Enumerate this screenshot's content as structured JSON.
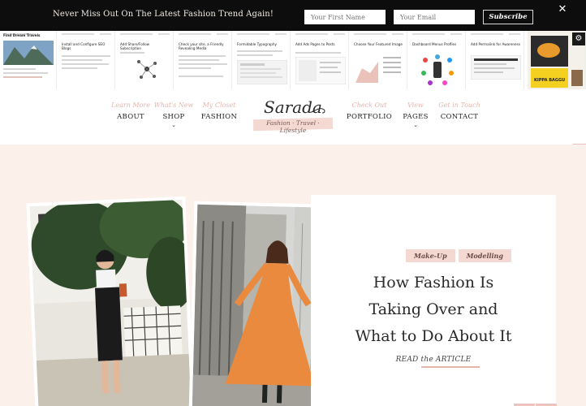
{
  "optin": {
    "message": "Never Miss Out On The Latest Fashion Trend Again!",
    "first_name_placeholder": "Your First Name",
    "email_placeholder": "Your Email",
    "subscribe_label": "Subscribe",
    "close_label": "✕"
  },
  "thumbnails": [
    {
      "title": "Find Dream Travels"
    },
    {
      "title": "Install and Configure SEO Blogs"
    },
    {
      "title": "Add Share/Follow Subscription"
    },
    {
      "title": "Check your site, a Friendly Revealing Media"
    },
    {
      "title": "Formidable Typography"
    },
    {
      "title": "Add Ads Pages to Posts"
    },
    {
      "title": "Choose Your Featured Image"
    },
    {
      "title": "Dashboard Menus Profiles"
    },
    {
      "title": "Add Permalink for Awareness"
    },
    {
      "title": "KIPPA BAGGU"
    }
  ],
  "settings_icon": "⚙",
  "nav": {
    "left": [
      {
        "sub": "Learn More",
        "label": "ABOUT",
        "has_dropdown": false
      },
      {
        "sub": "What's New",
        "label": "SHOP",
        "has_dropdown": true
      },
      {
        "sub": "My Closet",
        "label": "FASHION",
        "has_dropdown": false
      }
    ],
    "right": [
      {
        "sub": "Check Out",
        "label": "PORTFOLIO",
        "has_dropdown": false
      },
      {
        "sub": "View",
        "label": "PAGES",
        "has_dropdown": true
      },
      {
        "sub": "Get in Touch",
        "label": "CONTACT",
        "has_dropdown": false
      }
    ],
    "chevron": "⌄"
  },
  "logo": {
    "brand": "Sarada",
    "tagline": "Fashion · Travel · Lifestyle"
  },
  "feature": {
    "tags": [
      "Make-Up",
      "Modelling"
    ],
    "headline_lines": [
      "How Fashion Is",
      "Taking Over and",
      "What to Do About It"
    ],
    "read_label": "READ the ARTICLE"
  },
  "colors": {
    "accent_pink": "#f4d9d3",
    "nav_script": "#e6b6ad",
    "hero_bg": "#fbf0ea",
    "bar_bg": "#0d0d0d"
  }
}
